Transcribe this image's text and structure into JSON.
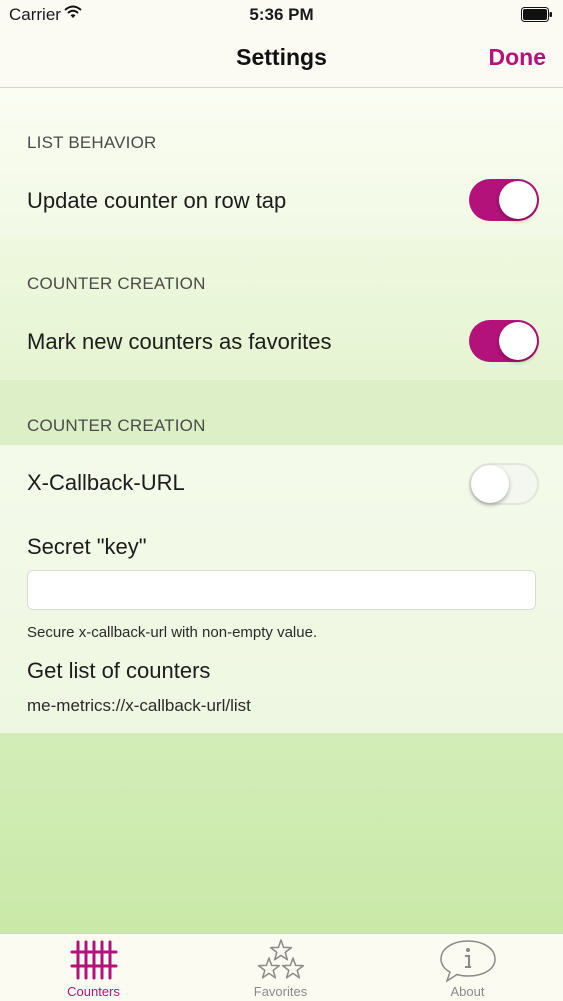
{
  "status_bar": {
    "carrier": "Carrier",
    "time": "5:36 PM"
  },
  "navbar": {
    "title": "Settings",
    "done_label": "Done"
  },
  "sections": [
    {
      "header": "LIST BEHAVIOR",
      "row_label": "Update counter on row tap",
      "toggle_on": true
    },
    {
      "header": "COUNTER CREATION",
      "row_label": "Mark new counters as favorites",
      "toggle_on": true
    },
    {
      "header": "COUNTER CREATION",
      "row_label": "X-Callback-URL",
      "toggle_on": false
    }
  ],
  "secret": {
    "label": "Secret \"key\"",
    "value": "",
    "hint": "Secure x-callback-url with non-empty value."
  },
  "list_counters": {
    "label": "Get list of counters",
    "url": "me-metrics://x-callback-url/list"
  },
  "tabs": [
    {
      "label": "Counters",
      "icon": "tally-marks-icon",
      "active": true
    },
    {
      "label": "Favorites",
      "icon": "stars-icon",
      "active": false
    },
    {
      "label": "About",
      "icon": "info-bubble-icon",
      "active": false
    }
  ],
  "colors": {
    "accent": "#b3127a",
    "bar_background": "#fbfbf3",
    "content_bottom": "#c4e8a2"
  }
}
